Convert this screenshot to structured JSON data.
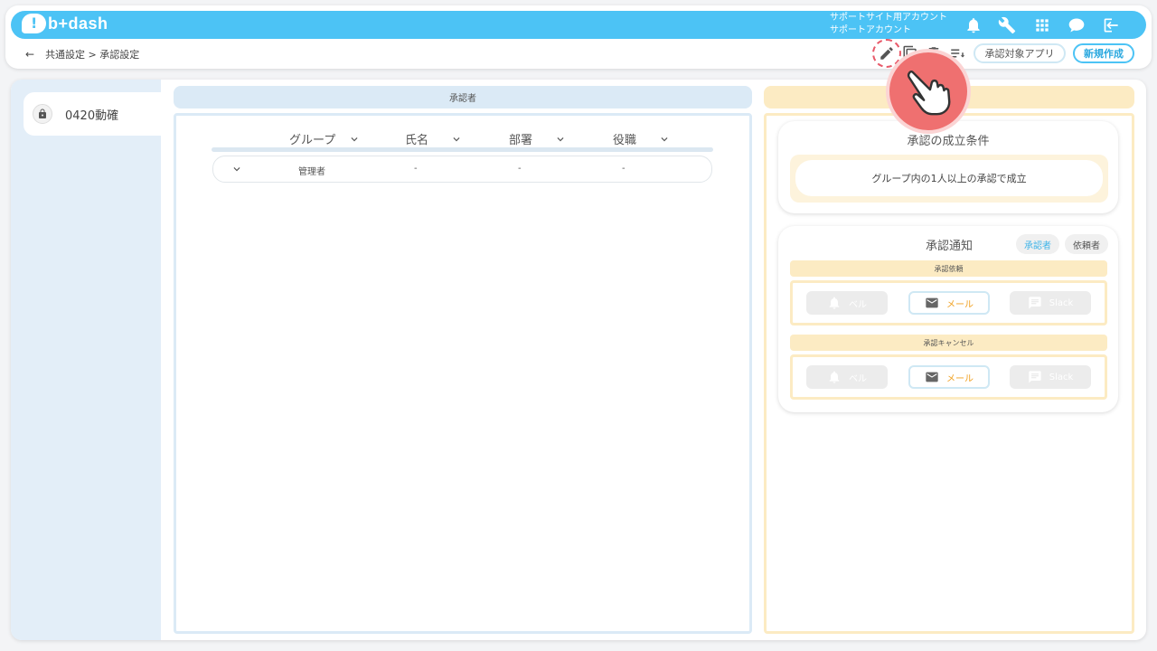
{
  "app": {
    "logo_text": "b+dash"
  },
  "header": {
    "account_line1": "サポートサイト用アカウント",
    "account_line2": "サポートアカウント",
    "icons": [
      "bell-icon",
      "wrench-icon",
      "grid-icon",
      "chat-icon",
      "logout-icon"
    ]
  },
  "breadcrumb": {
    "back": "←",
    "text": "共通設定 > 承認設定"
  },
  "toolbar": {
    "target_apps_label": "承認対象アプリ",
    "new_label": "新規作成",
    "icons": [
      "edit-icon",
      "copy-icon",
      "delete-icon",
      "sort-icon"
    ]
  },
  "sidebar": {
    "items": [
      {
        "label": "0420動確",
        "icon": "lock-icon"
      }
    ]
  },
  "approver": {
    "title": "承認者",
    "columns": [
      "グループ",
      "氏名",
      "部署",
      "役職"
    ],
    "rows": [
      {
        "group": "管理者",
        "name": "-",
        "dept": "-",
        "role": "-"
      }
    ]
  },
  "conditions": {
    "title": "承認の成立条件",
    "text": "グループ内の1人以上の承認で成立"
  },
  "notify": {
    "title": "承認通知",
    "tabs": [
      "承認者",
      "依頼者"
    ],
    "sections": [
      {
        "title": "承認依頼",
        "buttons": [
          "ベル",
          "メール",
          "Slack"
        ]
      },
      {
        "title": "承認キャンセル",
        "buttons": [
          "ベル",
          "メール",
          "Slack"
        ]
      }
    ]
  },
  "colors": {
    "brand": "#4cc3f5",
    "approver_tint": "#dbeaf6",
    "notify_tint": "#fcebc3",
    "mail_text": "#f0a020",
    "cursor": "#ef7070"
  }
}
